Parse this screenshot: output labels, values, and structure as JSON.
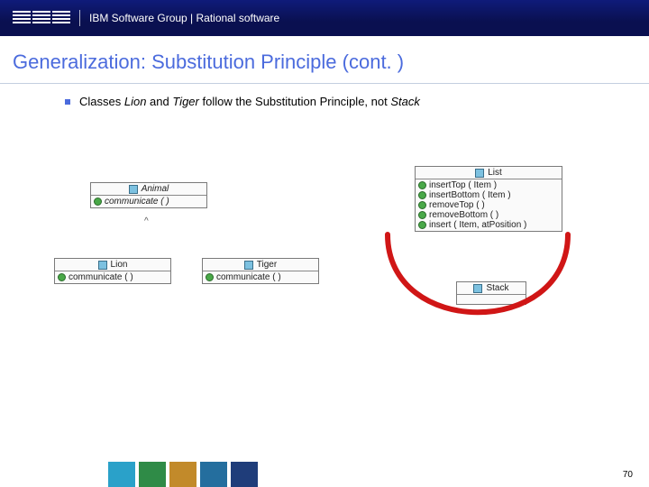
{
  "header": {
    "brand": "IBM",
    "text": "IBM Software Group | Rational software"
  },
  "title": "Generalization: Substitution Principle (cont. )",
  "bullet": {
    "classes_a": "Lion",
    "and": " and ",
    "classes_b": "Tiger",
    "follow": " follow the Substitution Principle, not ",
    "classes_c": "Stack",
    "lead": "Classes "
  },
  "uml": {
    "animal": {
      "name": "Animal",
      "op1": "communicate ( )"
    },
    "lion": {
      "name": "Lion",
      "op1": "communicate ( )"
    },
    "tiger": {
      "name": "Tiger",
      "op1": "communicate ( )"
    },
    "list": {
      "name": "List",
      "op1": "insertTop ( Item )",
      "op2": "insertBottom ( Item )",
      "op3": "removeTop ( )",
      "op4": "removeBottom ( )",
      "op5": "insert ( Item, atPosition )"
    },
    "stack": {
      "name": "Stack"
    }
  },
  "page_number": "70",
  "connector_caret": "^"
}
